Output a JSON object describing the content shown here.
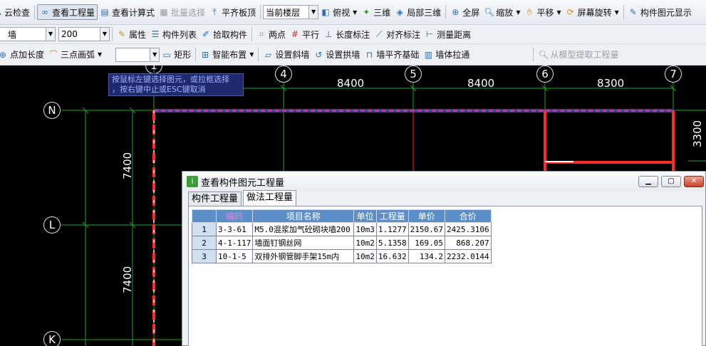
{
  "toolbar1": {
    "items": [
      {
        "icon": "cloud-check-icon",
        "label": "云检查"
      },
      {
        "icon": "view-quantity-icon",
        "label": "查看工程量"
      },
      {
        "icon": "formula-icon",
        "label": "查看计算式"
      },
      {
        "icon": "batch-select-icon",
        "label": "批量选择"
      },
      {
        "icon": "align-slab-top-icon",
        "label": "平齐板顶"
      },
      {
        "label": "当前楼层"
      },
      {
        "icon": "top-view-icon",
        "label": "俯视"
      },
      {
        "icon": "3d-icon",
        "label": "三维"
      },
      {
        "icon": "local-3d-icon",
        "label": "局部三维"
      },
      {
        "icon": "full-view-icon",
        "label": "全屏"
      },
      {
        "icon": "zoom-icon",
        "label": "缩放"
      },
      {
        "icon": "pan-icon",
        "label": "平移"
      },
      {
        "icon": "rotate-screen-icon",
        "label": "屏幕旋转"
      },
      {
        "icon": "component-display-icon",
        "label": "构件图元显示"
      }
    ]
  },
  "toolbar2": {
    "type_value": "墙",
    "size_value": "200",
    "items": [
      {
        "icon": "properties-icon",
        "label": "属性"
      },
      {
        "icon": "component-list-icon",
        "label": "构件列表"
      },
      {
        "icon": "pick-component-icon",
        "label": "拾取构件"
      },
      {
        "icon": "two-point-icon",
        "label": "两点"
      },
      {
        "icon": "parallel-icon",
        "label": "平行"
      },
      {
        "icon": "length-dimension-icon",
        "label": "长度标注"
      },
      {
        "icon": "align-dimension-icon",
        "label": "对齐标注"
      },
      {
        "icon": "measure-distance-icon",
        "label": "测量距离"
      }
    ]
  },
  "toolbar3": {
    "items": [
      {
        "icon": "point-length-icon",
        "label": "点加长度"
      },
      {
        "icon": "arc-icon",
        "label": "三点画弧"
      },
      {
        "icon": "rectangle-icon",
        "label": "矩形"
      },
      {
        "icon": "smart-layout-icon",
        "label": "智能布置"
      },
      {
        "icon": "slope-wall-icon",
        "label": "设置斜墙"
      },
      {
        "icon": "arch-wall-icon",
        "label": "设置拱墙"
      },
      {
        "icon": "wall-align-foundation-icon",
        "label": "墙平齐基础"
      },
      {
        "icon": "wall-stretch-icon",
        "label": "墙体拉通"
      },
      {
        "icon": "extract-quantity-icon",
        "label": "从模型提取工程量"
      }
    ]
  },
  "canvas": {
    "tip": "按鼠标左键选择图元，或拉框选择\n，按右键中止或ESC键取消",
    "top_axes": [
      "4",
      "5",
      "6",
      "7"
    ],
    "partial_axis": "1",
    "left_axes": [
      "N",
      "L",
      "K"
    ],
    "dims_top": [
      "8400",
      "8400",
      "8300"
    ],
    "dims_left": [
      "7400",
      "7400"
    ],
    "dim_right": "3300"
  },
  "dialog": {
    "title": "查看构件图元工程量",
    "tabs": [
      "构件工程量",
      "做法工程量"
    ],
    "columns": [
      "编码",
      "项目名称",
      "单位",
      "工程量",
      "单价",
      "合价"
    ],
    "rows": [
      {
        "idx": "1",
        "code": "3-3-61",
        "name": "M5.0混浆加气砼砌块墙200",
        "unit": "10m3",
        "qty": "1.1277",
        "price": "2150.67",
        "total": "2425.3106"
      },
      {
        "idx": "2",
        "code": "4-1-117",
        "name": "墙面钉钢丝网",
        "unit": "10m2",
        "qty": "5.1358",
        "price": "169.05",
        "total": "868.207"
      },
      {
        "idx": "3",
        "code": "10-1-5",
        "name": "双排外钢管脚手架15m内",
        "unit": "10m2",
        "qty": "16.632",
        "price": "134.2",
        "total": "2232.0144"
      }
    ]
  }
}
